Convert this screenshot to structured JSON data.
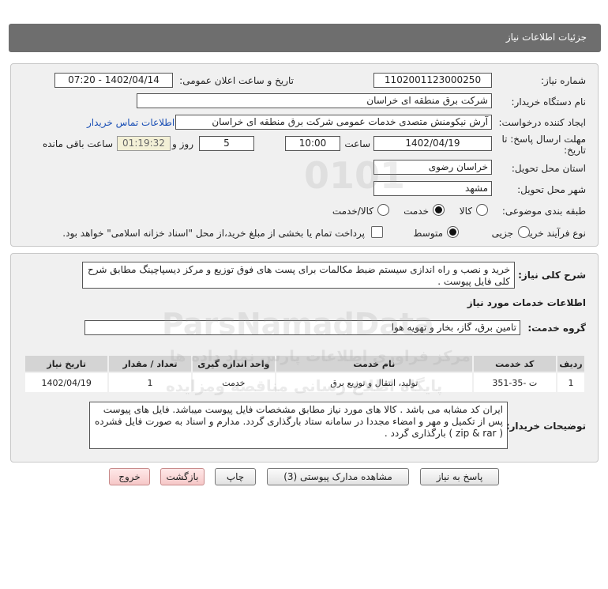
{
  "header": {
    "title": "جزئیات اطلاعات نیاز"
  },
  "need_number": {
    "label": "شماره نیاز:",
    "value": "1102001123000250"
  },
  "announce_datetime": {
    "label": "تاریخ و ساعت اعلان عمومی:",
    "value": "1402/04/14 - 07:20"
  },
  "buyer_org": {
    "label": "نام دستگاه خریدار:",
    "value": "شرکت برق منطقه ای خراسان"
  },
  "requester": {
    "label": "ایجاد کننده درخواست:",
    "value": "آرش نیکومنش متصدی خدمات عمومی شرکت برق منطقه ای خراسان",
    "contact_link": "اطلاعات تماس خریدار"
  },
  "deadline": {
    "label_line1": "مهلت ارسال پاسخ: تا",
    "label_line2": "تاریخ:",
    "date": "1402/04/19",
    "time_label": "ساعت",
    "time": "10:00",
    "days": "5",
    "days_label": "روز و",
    "remaining": "01:19:32",
    "remaining_label": "ساعت باقی مانده"
  },
  "delivery_province": {
    "label": "استان محل تحویل:",
    "value": "خراسان رضوی"
  },
  "delivery_city": {
    "label": "شهر محل تحویل:",
    "value": "مشهد"
  },
  "category": {
    "label": "طبقه بندی موضوعی:",
    "options": [
      "کالا",
      "خدمت",
      "کالا/خدمت"
    ],
    "selected": "خدمت"
  },
  "purchase_type": {
    "label": "نوع فرآیند خرید :",
    "options": [
      "جزیی",
      "متوسط"
    ],
    "selected": "متوسط",
    "treasury_note": "پرداخت تمام یا بخشی از مبلغ خرید،از محل \"اسناد خزانه اسلامی\" خواهد بود."
  },
  "description": {
    "label": "شرح کلی نیاز:",
    "value": "خرید و نصب و راه اندازی سیستم ضبط مکالمات برای پست های فوق توزیع و مرکز دیسپاچینگ مطابق شرح کلی فایل پیوست ."
  },
  "services_title": "اطلاعات خدمات مورد نیاز",
  "service_group": {
    "label": "گروه خدمت:",
    "value": "تامین برق، گاز، بخار و تهویه هوا"
  },
  "table": {
    "headers": [
      "ردیف",
      "کد خدمت",
      "نام خدمت",
      "واحد اندازه گیری",
      "تعداد / مقدار",
      "تاریخ نیاز"
    ],
    "rows": [
      [
        "1",
        "ت -35-351",
        "تولید، انتقال و توزیع برق",
        "خدمت",
        "1",
        "1402/04/19"
      ]
    ]
  },
  "buyer_notes": {
    "label": "توضیحات خریدار:",
    "value": "ایران کد مشابه می باشد . کالا های مورد نیاز مطابق مشخصات فایل پیوست میباشد. فایل های پیوست پس از تکمیل و مهر و امضاء مجددا در سامانه ستاد بارگذاری گردد. مدارم و اسناد به صورت فایل فشرده ( zip & rar ) بارگذاری گردد ."
  },
  "buttons": {
    "reply": "پاسخ به نیاز",
    "attachments": "مشاهده مدارک پیوستی (3)",
    "print": "چاپ",
    "back": "بازگشت",
    "exit": "خروج"
  },
  "watermark": {
    "brand": "ParsNamadData",
    "line1": "مرکز فراوری اطلاعات پارس نماد داده ها",
    "line2": "پایگاه اطلاع رسانی مناقصه ومزایده"
  },
  "colors": {
    "header_bg": "#6e6e6e",
    "panel_bg": "#f0f0f0",
    "link": "#1a4fb5",
    "timer_bg": "#f3f0d6"
  }
}
